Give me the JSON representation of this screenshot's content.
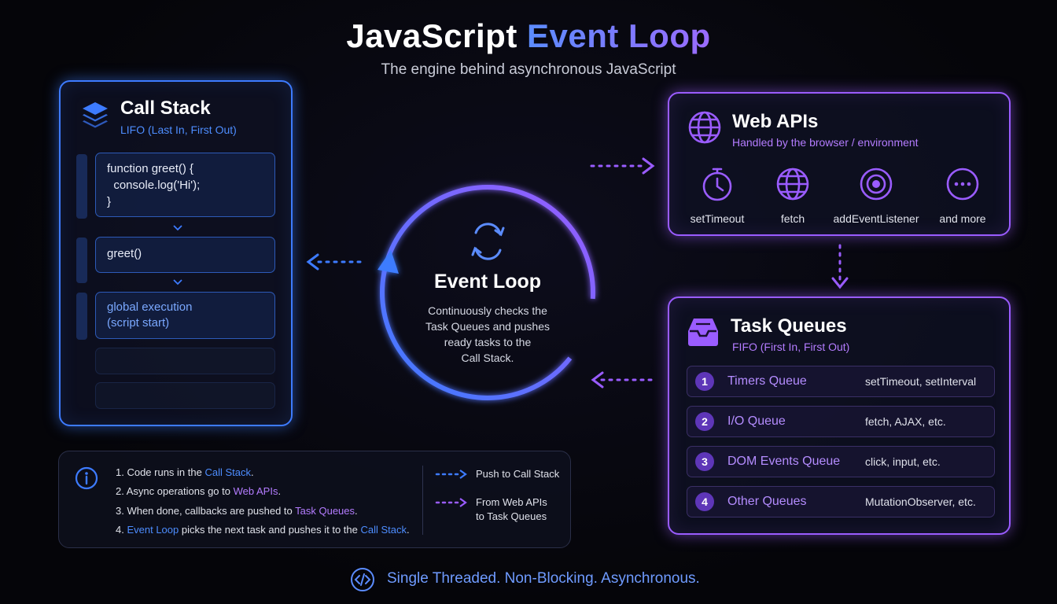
{
  "header": {
    "title_part1": "JavaScript",
    "title_part2": "Event Loop",
    "subtitle": "The engine behind asynchronous JavaScript"
  },
  "call_stack": {
    "title": "Call Stack",
    "subtitle": "LIFO (Last In, First Out)",
    "frames": [
      {
        "line1": "function greet() {",
        "line2": "  console.log('Hi');",
        "line3": "}"
      },
      {
        "line1": "greet()"
      },
      {
        "line1": "global execution",
        "line2": "(script start)"
      }
    ]
  },
  "event_loop": {
    "title": "Event Loop",
    "desc_line1": "Continuously checks the",
    "desc_line2": "Task Queues and pushes",
    "desc_line3": "ready tasks to the",
    "desc_line4": "Call Stack."
  },
  "web_apis": {
    "title": "Web APIs",
    "subtitle": "Handled by the browser / environment",
    "items": [
      {
        "label": "setTimeout",
        "icon": "stopwatch-icon"
      },
      {
        "label": "fetch",
        "icon": "globe-icon"
      },
      {
        "label": "addEventListener",
        "icon": "target-icon"
      },
      {
        "label": "and more",
        "icon": "more-dots-icon"
      }
    ]
  },
  "task_queues": {
    "title": "Task Queues",
    "subtitle": "FIFO (First In, First Out)",
    "queues": [
      {
        "num": "1",
        "name": "Timers Queue",
        "examples": "setTimeout, setInterval"
      },
      {
        "num": "2",
        "name": "I/O Queue",
        "examples": "fetch, AJAX, etc."
      },
      {
        "num": "3",
        "name": "DOM Events Queue",
        "examples": "click, input, etc."
      },
      {
        "num": "4",
        "name": "Other Queues",
        "examples": "MutationObserver, etc."
      }
    ]
  },
  "legend": {
    "steps": [
      {
        "pre": "1. Code runs in the ",
        "hl": "Call Stack",
        "post": "."
      },
      {
        "pre": "2. Async operations go to ",
        "hl": "Web APIs",
        "post": "."
      },
      {
        "pre": "3. When done, callbacks are pushed to ",
        "hl": "Task Queues",
        "post": "."
      },
      {
        "num": "4. ",
        "hl1": "Event Loop",
        "mid": " picks the next task and pushes it to the ",
        "hl2": "Call Stack",
        "post": "."
      }
    ],
    "key_blue": "Push to Call Stack",
    "key_purple_line1": "From Web APIs",
    "key_purple_line2": "to Task Queues"
  },
  "footer": {
    "tagline": "Single Threaded. Non-Blocking. Asynchronous."
  },
  "colors": {
    "blue_accent": "#3d7bff",
    "purple_accent": "#9a5cff",
    "background": "#050509"
  }
}
